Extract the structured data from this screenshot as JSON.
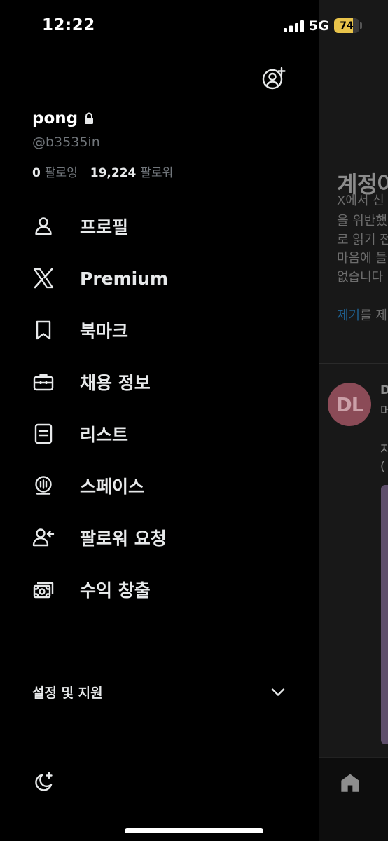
{
  "status_bar": {
    "time": "12:22",
    "network": "5G",
    "battery": "74",
    "battery_level": 0.74,
    "battery_color": "#e8c34a"
  },
  "profile": {
    "display_name": "pong",
    "handle": "@b3535in",
    "following_count": "0",
    "following_label": "팔로잉",
    "followers_count": "19,224",
    "followers_label": "팔로워"
  },
  "menu": {
    "items": [
      {
        "label": "프로필",
        "icon": "person-icon"
      },
      {
        "label": "Premium",
        "icon": "x-logo-icon"
      },
      {
        "label": "북마크",
        "icon": "bookmark-icon"
      },
      {
        "label": "채용 정보",
        "icon": "briefcase-icon"
      },
      {
        "label": "리스트",
        "icon": "list-icon"
      },
      {
        "label": "스페이스",
        "icon": "spaces-icon"
      },
      {
        "label": "팔로워 요청",
        "icon": "follower-request-icon"
      },
      {
        "label": "수익 창출",
        "icon": "money-icon"
      }
    ]
  },
  "settings": {
    "label": "설정 및 지원",
    "icon": "chevron-down-icon"
  },
  "background": {
    "heading": "계정이",
    "lines": [
      "X에서 신",
      "을 위반했",
      "로 읽기 전",
      "마음에 들",
      "없습니다"
    ],
    "link_text": "제기",
    "link_suffix": "를 제",
    "avatar_initials": "DL",
    "tweet_name": "D",
    "tweet_sub": "머",
    "tweet_text_1": "지",
    "tweet_text_2": "(",
    "colors": {
      "link": "#1f5f8e",
      "avatar": "#8b4b57"
    }
  }
}
